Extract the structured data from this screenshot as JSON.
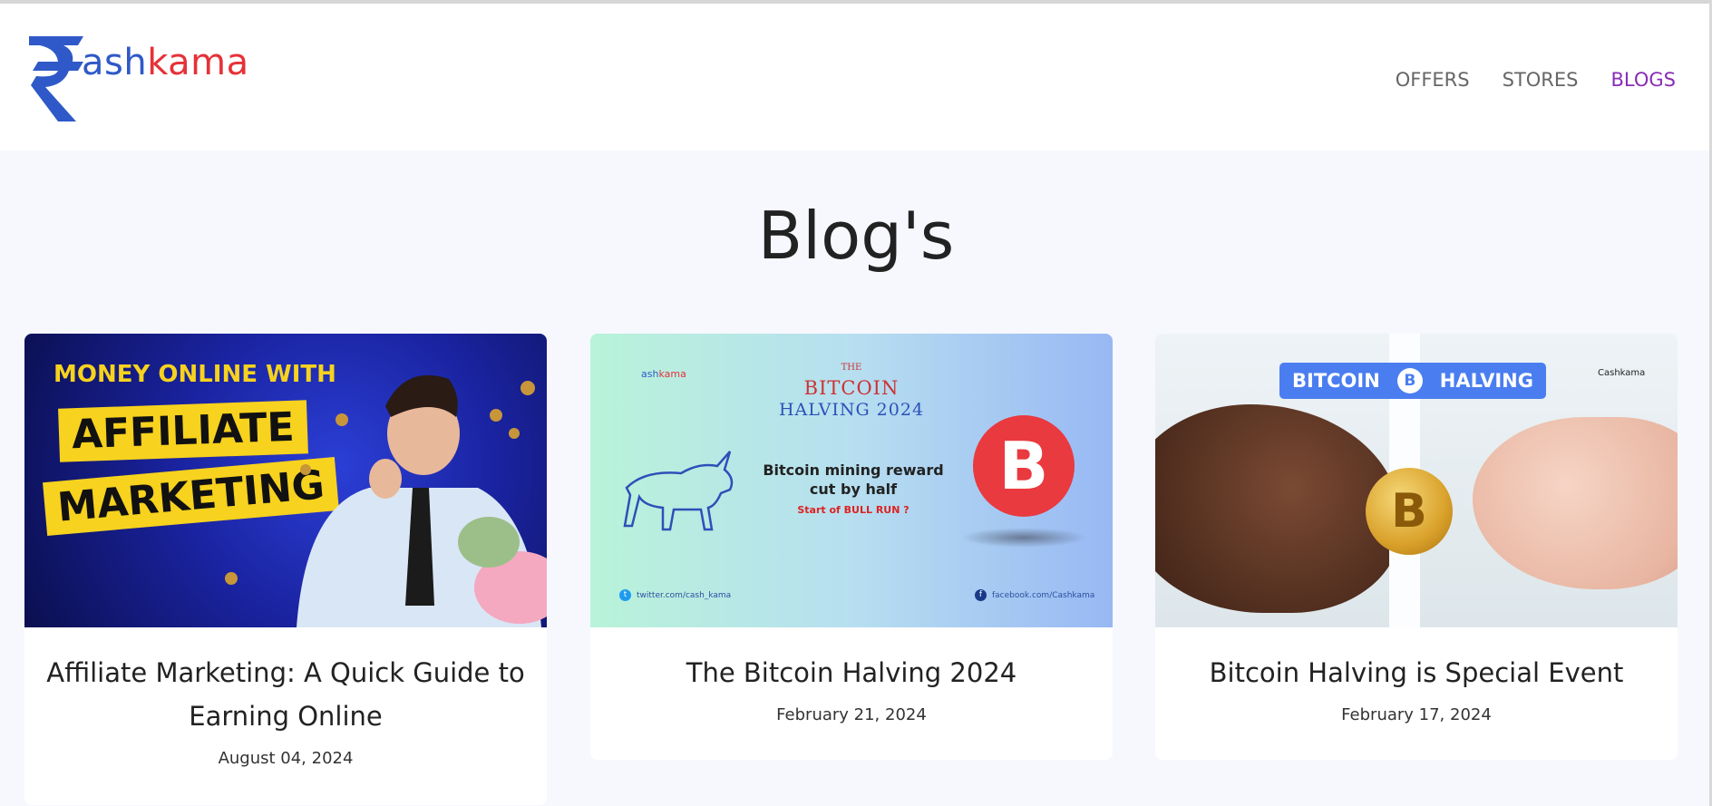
{
  "brand": {
    "logo_part1": "ashkama",
    "logo_part1_prefix": "",
    "logo_blue": "ash",
    "logo_red": "kama",
    "blue": "#2f59c8",
    "red": "#e53238"
  },
  "nav": {
    "items": [
      {
        "label": "OFFERS"
      },
      {
        "label": "STORES"
      },
      {
        "label": "BLOGS"
      }
    ],
    "active": "BLOGS",
    "active_color": "#8a2cb8"
  },
  "page": {
    "title": "Blog's"
  },
  "cards": [
    {
      "title": "Affiliate Marketing: A Quick Guide to Earning Online",
      "date": "August 04, 2024",
      "thumb": {
        "headline": "MONEY ONLINE WITH",
        "line1": "AFFILIATE",
        "line2": "MARKETING"
      }
    },
    {
      "title": "The Bitcoin Halving 2024",
      "date": "February 21, 2024",
      "thumb": {
        "logo_blue": "ash",
        "logo_red": "kama",
        "the": "THE",
        "title": "BITCOIN",
        "subtitle": "HALVING 2024",
        "reward_line1": "Bitcoin mining reward",
        "reward_line2": "cut by half",
        "bull": "Start of BULL RUN ?",
        "coin": "B",
        "twitter": "twitter.com/cash_kama",
        "facebook": "facebook.com/Cashkama"
      }
    },
    {
      "title": "Bitcoin Halving is Special Event",
      "date": "February 17, 2024",
      "thumb": {
        "left_word": "BITCOIN",
        "right_word": "HALVING",
        "coin": "B",
        "mini_logo": "Cashkama"
      }
    }
  ]
}
